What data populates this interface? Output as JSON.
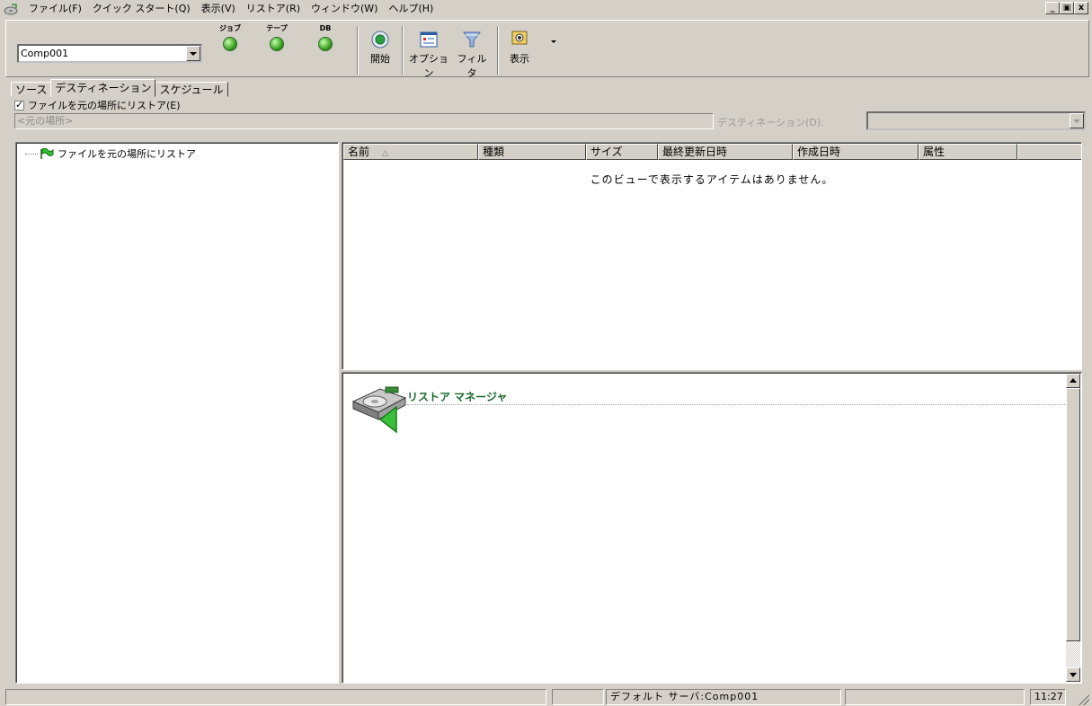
{
  "menu": {
    "items": [
      "ファイル(F)",
      "クイック スタート(Q)",
      "表示(V)",
      "リストア(R)",
      "ウィンドウ(W)",
      "ヘルプ(H)"
    ],
    "window_controls": [
      "_",
      "ₐ",
      "x"
    ]
  },
  "toolbar": {
    "server_select": "Comp001",
    "leds": [
      "ジョブ",
      "テープ",
      "DB"
    ],
    "led_color": "#3aa020",
    "buttons": [
      {
        "label": "開始",
        "icon": "start-icon"
      },
      {
        "label": "オプション",
        "icon": "options-icon"
      },
      {
        "label": "フィルタ",
        "icon": "filter-icon"
      },
      {
        "label": "表示",
        "icon": "view-icon"
      }
    ]
  },
  "tabs": [
    "ソース",
    "デスティネーション",
    "スケジュール"
  ],
  "active_tab": "デスティネーション",
  "restore_original": {
    "checkbox_label": "ファイルを元の場所にリストア(E)",
    "checked": true,
    "path_placeholder": "<元の場所>",
    "destination_label": "デスティネーション(D):",
    "destination_value": ""
  },
  "tree": {
    "root_label": "ファイルを元の場所にリストア",
    "root_icon": "green-flag-icon"
  },
  "file_list": {
    "columns": [
      "名前",
      "種類",
      "サイズ",
      "最終更新日時",
      "作成日時",
      "属性"
    ],
    "sort_indicator": "△",
    "empty_message": "このビューで表示するアイテムはありません。"
  },
  "restore_manager": {
    "title": "リストア マネージャ",
    "title_color": "#1a6a2a"
  },
  "statusbar": {
    "panels": [
      "",
      "",
      "デフォルト サーバ:Comp001",
      "",
      "11:27"
    ]
  }
}
